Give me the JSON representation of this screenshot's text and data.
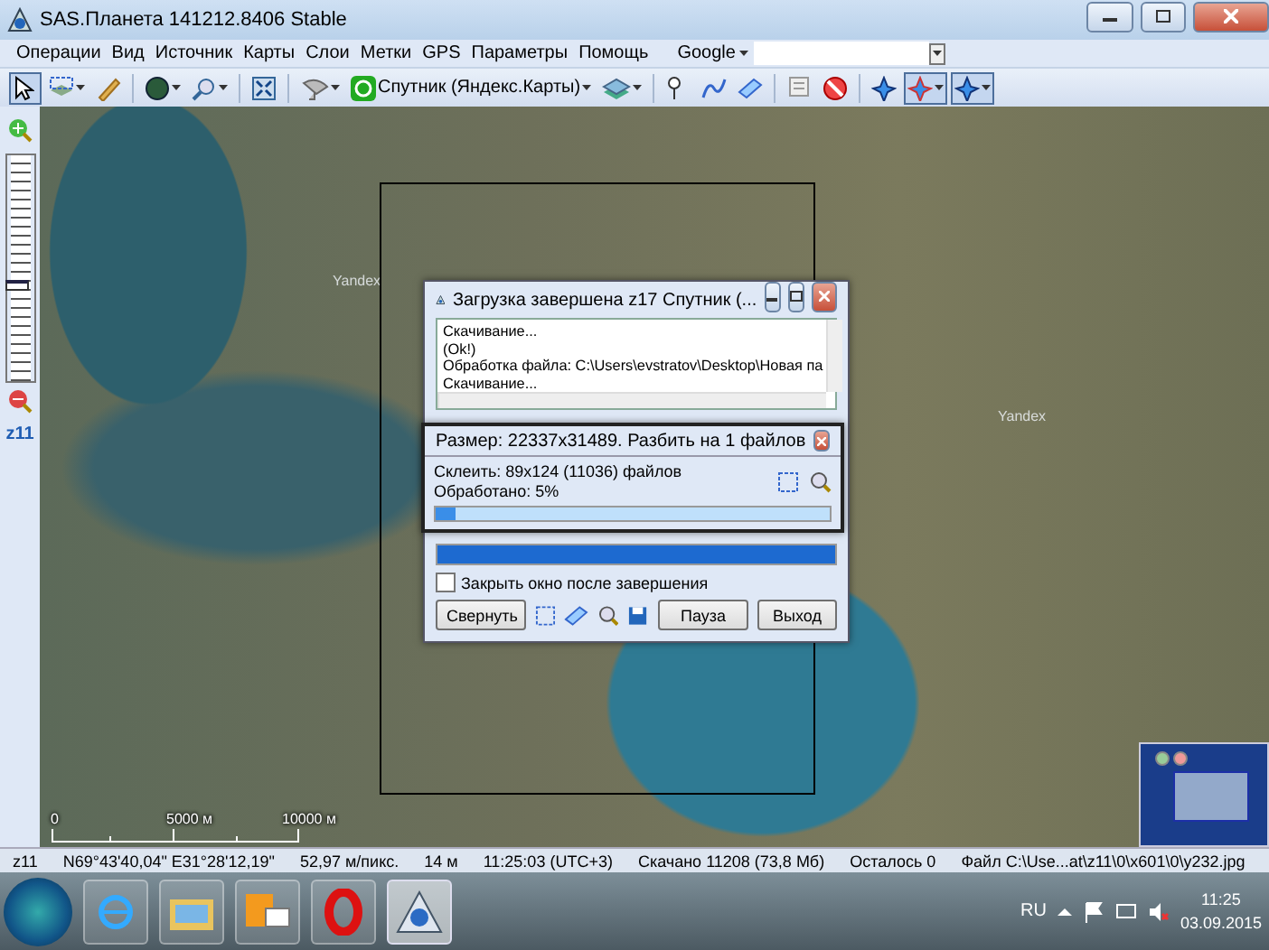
{
  "window": {
    "title": "SAS.Планета 141212.8406 Stable"
  },
  "menu": [
    "Операции",
    "Вид",
    "Источник",
    "Карты",
    "Слои",
    "Метки",
    "GPS",
    "Параметры",
    "Помощь"
  ],
  "search": {
    "provider": "Google"
  },
  "toolbar": [
    {
      "kind": "tool",
      "pressed": true
    },
    {
      "kind": "tool",
      "pressed": false
    },
    {
      "kind": "tool",
      "pressed": false
    },
    {
      "kind": "separator"
    },
    {
      "kind": "tool",
      "pressed": false
    },
    {
      "kind": "tool",
      "pressed": false
    },
    {
      "kind": "separator"
    },
    {
      "kind": "tool",
      "pressed": false
    },
    {
      "kind": "separator"
    },
    {
      "kind": "tool",
      "pressed": false
    },
    {
      "kind": "map",
      "label": "Спутник (Яндекс.Карты)"
    },
    {
      "kind": "tool",
      "pressed": false
    },
    {
      "kind": "separator"
    },
    {
      "kind": "tool",
      "pressed": false
    },
    {
      "kind": "tool",
      "pressed": false
    },
    {
      "kind": "tool",
      "pressed": false
    },
    {
      "kind": "separator"
    },
    {
      "kind": "tool",
      "pressed": false
    },
    {
      "kind": "tool",
      "pressed": false
    },
    {
      "kind": "separator"
    },
    {
      "kind": "tool",
      "pressed": false
    },
    {
      "kind": "tool",
      "pressed": true
    },
    {
      "kind": "tool",
      "pressed": true
    }
  ],
  "zoom": {
    "level": 0.42,
    "label": "z11"
  },
  "map": {
    "watermarks": [
      "Yandex",
      "Yandex"
    ],
    "scale": [
      "0",
      "5000 м",
      "10000 м"
    ]
  },
  "download_dialog": {
    "title": "Загрузка завершена z17 Спутник (...",
    "log": [
      "Скачивание...",
      "(Ok!)",
      "Обработка файла: C:\\Users\\evstratov\\Desktop\\Новая па",
      "Скачивание..."
    ],
    "progress": {
      "level": 1
    },
    "close_on_finish": {
      "label": "Закрыть окно после завершения",
      "checked": false
    },
    "buttons": [
      "Свернуть",
      "Пауза",
      "Выход"
    ]
  },
  "split_dialog": {
    "title": "Размер: 22337x31489. Разбить на 1 файлов",
    "lines": [
      "Склеить: 89x124 (11036) файлов",
      "Обработано: 5%"
    ],
    "progress": {
      "level": 0.05
    }
  },
  "status": [
    "z11",
    "N69°43'40,04\" E31°28'12,19\"",
    "52,97 м/пикс.",
    "14 м",
    "11:25:03 (UTC+3)",
    "Скачано 11208 (73,8 Мб)",
    "Осталось 0",
    "Файл C:\\Use...at\\z11\\0\\x601\\0\\y232.jpg"
  ],
  "taskbar": {
    "apps": [
      {
        "selected": false
      },
      {
        "selected": false
      },
      {
        "selected": false
      },
      {
        "selected": false
      },
      {
        "selected": true
      }
    ],
    "language": "RU",
    "time": "11:25",
    "date": "03.09.2015"
  }
}
